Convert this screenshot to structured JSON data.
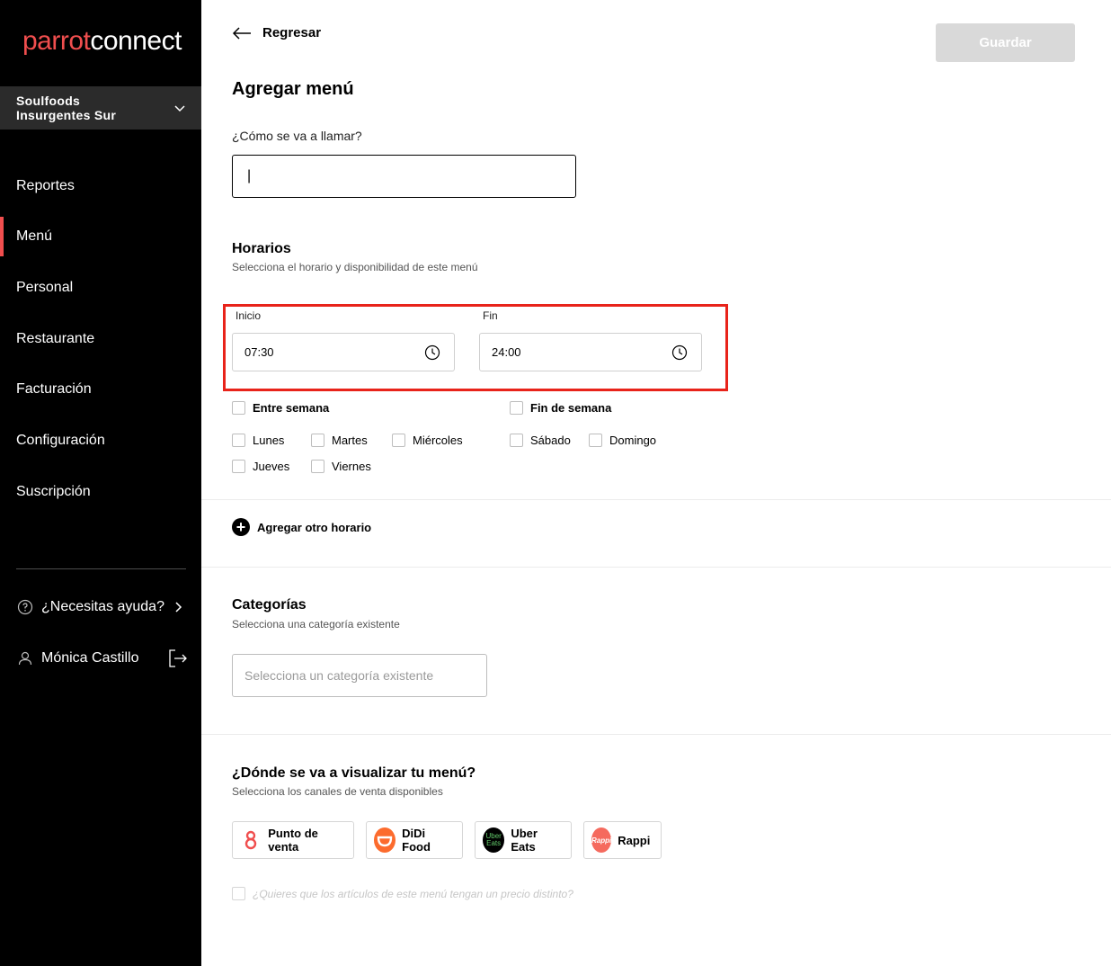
{
  "brand": {
    "part1": "parrot",
    "part2": "connect"
  },
  "store": {
    "name": "Soulfoods Insurgentes Sur"
  },
  "sidebar": {
    "items": [
      {
        "label": "Reportes"
      },
      {
        "label": "Menú"
      },
      {
        "label": "Personal"
      },
      {
        "label": "Restaurante"
      },
      {
        "label": "Facturación"
      },
      {
        "label": "Configuración"
      },
      {
        "label": "Suscripción"
      }
    ],
    "help": "¿Necesitas ayuda?",
    "user": "Mónica Castillo"
  },
  "header": {
    "back_label": "Regresar",
    "save_label": "Guardar"
  },
  "page": {
    "title": "Agregar menú"
  },
  "name_field": {
    "label": "¿Cómo se va a llamar?",
    "value": "|"
  },
  "schedule": {
    "title": "Horarios",
    "subtitle": "Selecciona el horario y disponibilidad de este menú",
    "start_label": "Inicio",
    "start_value": "07:30",
    "end_label": "Fin",
    "end_value": "24:00",
    "weekdays_label": "Entre semana",
    "weekend_label": "Fin de semana",
    "days": {
      "mon": "Lunes",
      "tue": "Martes",
      "wed": "Miércoles",
      "thu": "Jueves",
      "fri": "Viernes",
      "sat": "Sábado",
      "sun": "Domingo"
    },
    "add_label": "Agregar otro horario"
  },
  "categories": {
    "title": "Categorías",
    "subtitle": "Selecciona una categoría existente",
    "placeholder": "Selecciona un categoría existente"
  },
  "channels": {
    "title": "¿Dónde se va a visualizar tu menú?",
    "subtitle": "Selecciona los canales de venta disponibles",
    "items": [
      {
        "label": "Punto de venta"
      },
      {
        "label": "DiDi Food"
      },
      {
        "label": "Uber Eats",
        "icon_text": "Uber Eats"
      },
      {
        "label": "Rappi",
        "icon_text": "Rappi"
      }
    ],
    "price_question": "¿Quieres que los artículos de este menú tengan un precio distinto?"
  },
  "colors": {
    "accent": "#f04e4e",
    "highlight": "#e8231a",
    "didi": "#fc6b2d",
    "rappi": "#f56a5e"
  }
}
